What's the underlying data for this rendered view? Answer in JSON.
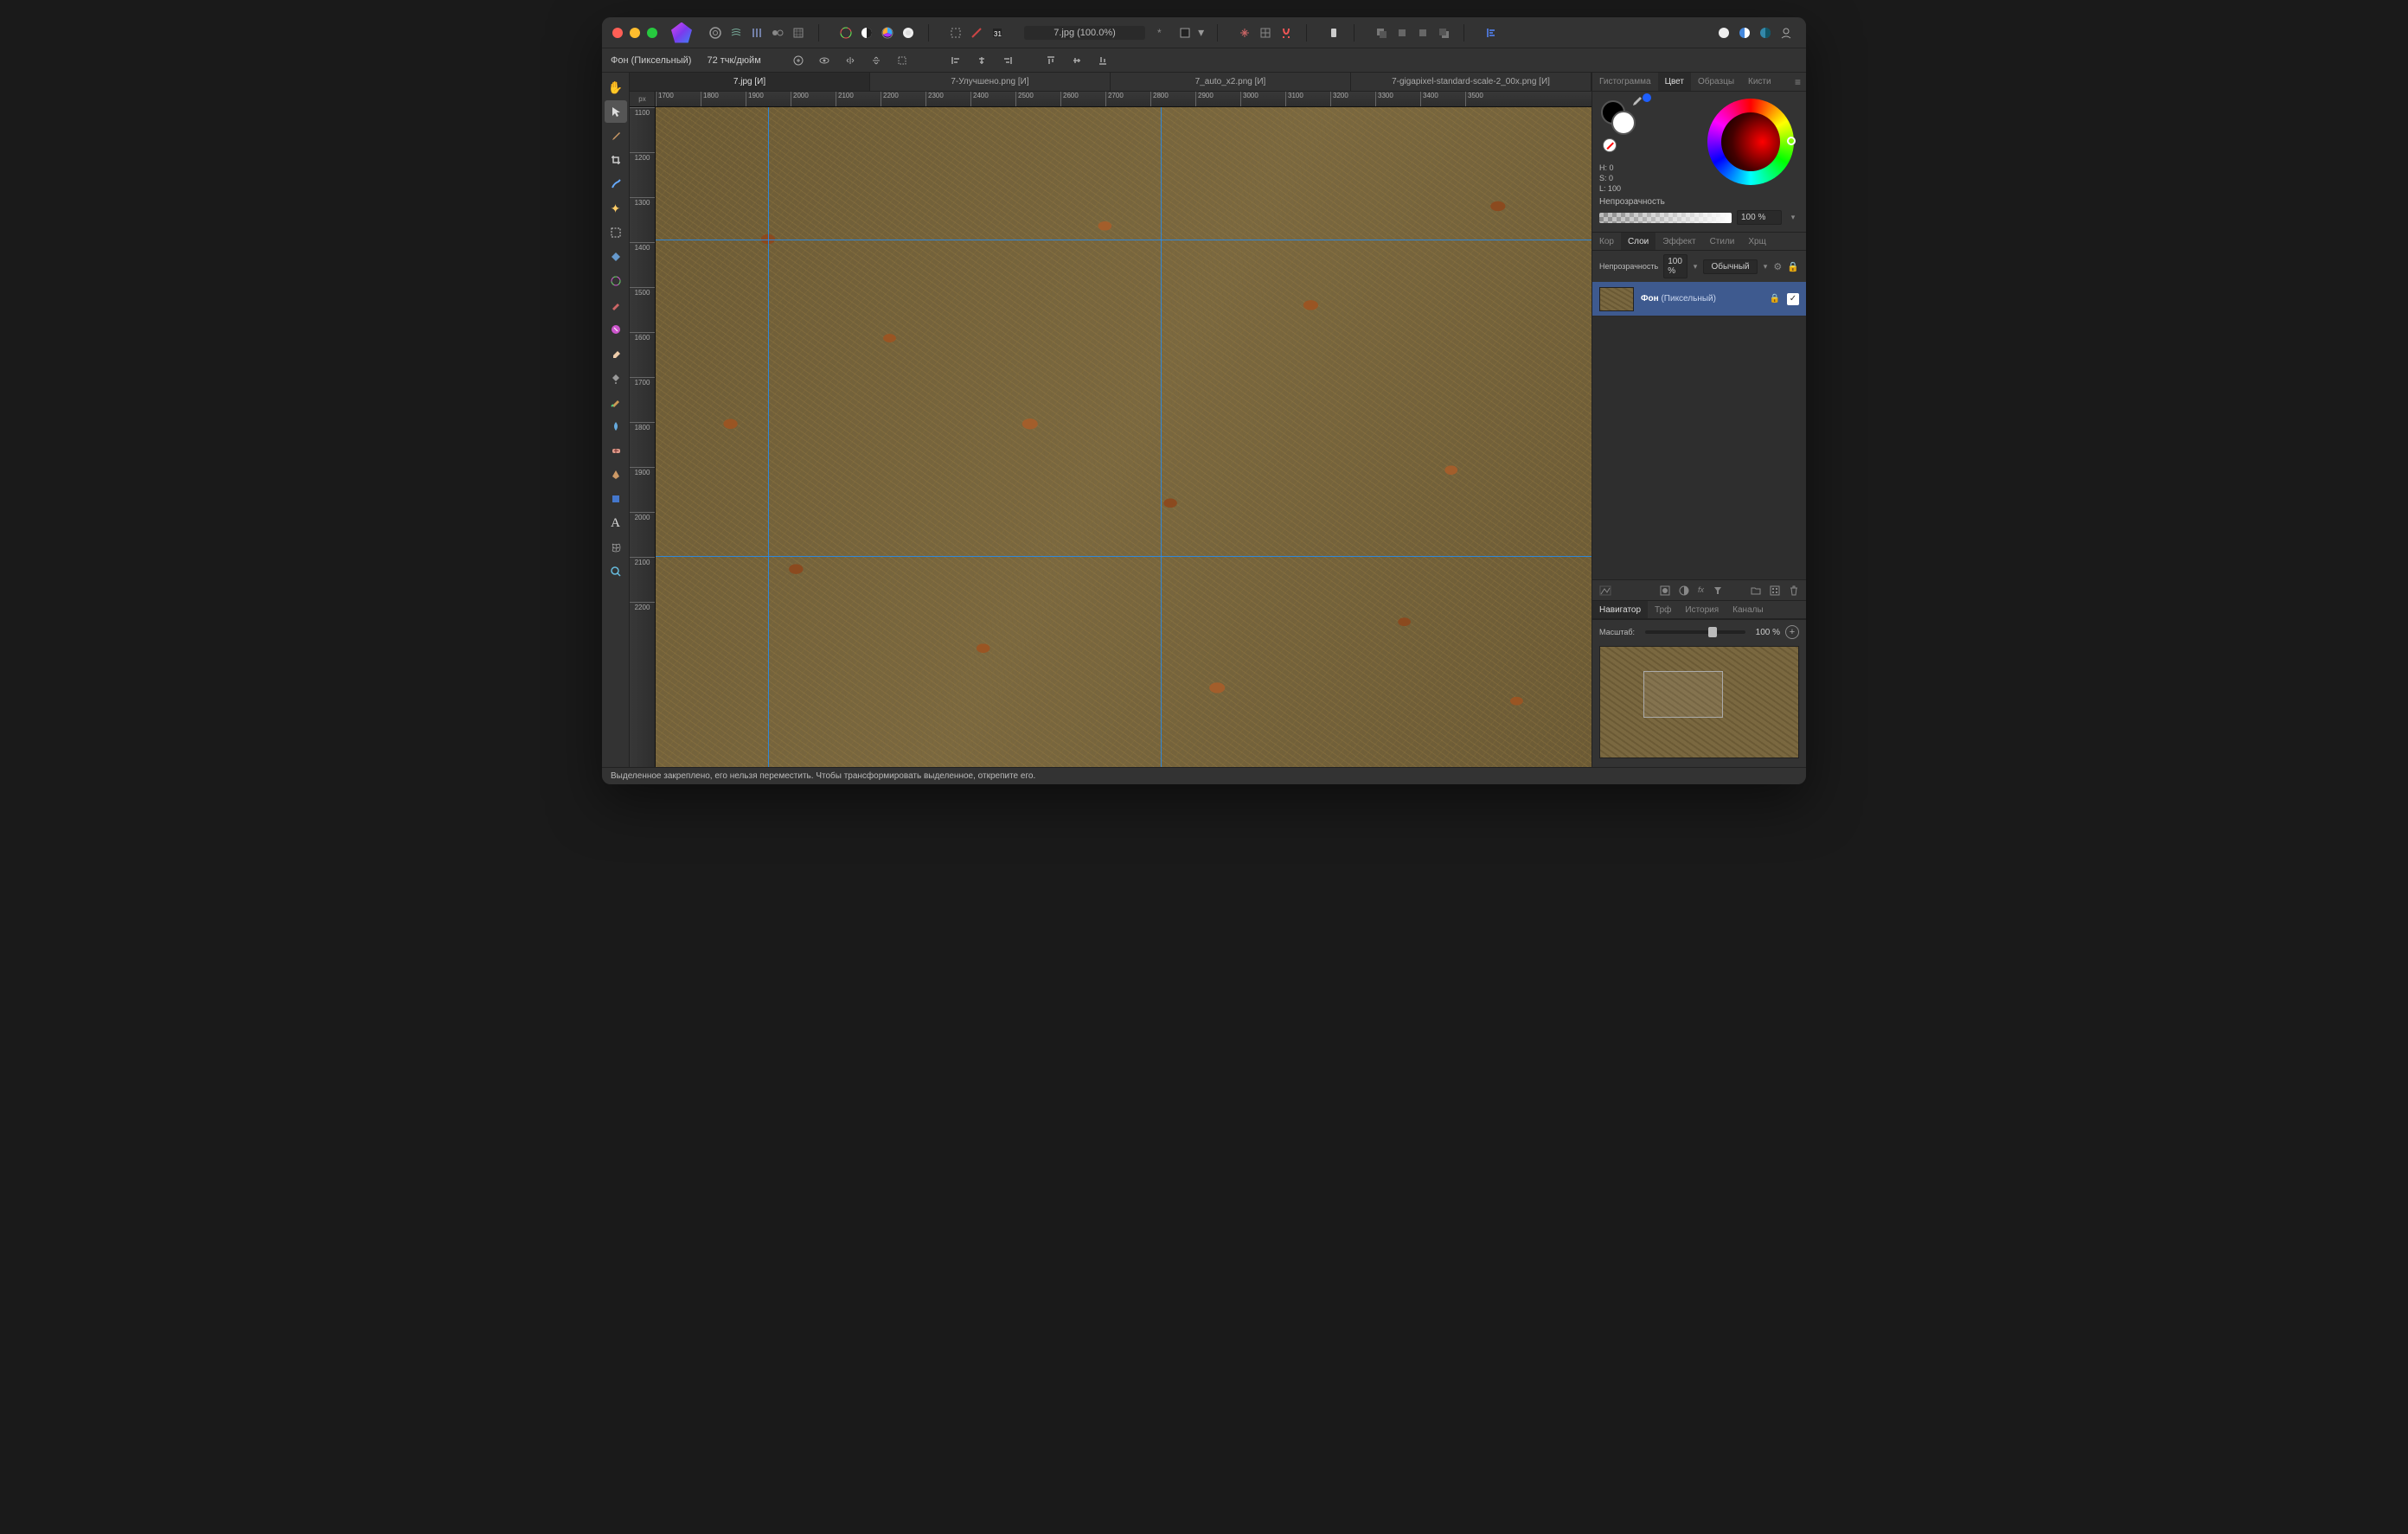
{
  "titlebar": {
    "doc_title": "7.jpg (100.0%)",
    "dirty_marker": "*"
  },
  "contextbar": {
    "layer_label": "Фон (Пиксельный)",
    "dpi": "72 тчк/дюйм"
  },
  "doc_tabs": [
    "7.jpg [И]",
    "7-Улучшено.png [И]",
    "7_auto_x2.png [И]",
    "7-gigapixel-standard-scale-2_00x.png [И]"
  ],
  "rulers": {
    "unit": "px",
    "h_ticks": [
      "1700",
      "1800",
      "1900",
      "2000",
      "2100",
      "2200",
      "2300",
      "2400",
      "2500",
      "2600",
      "2700",
      "2800",
      "2900",
      "3000",
      "3100",
      "3200",
      "3300",
      "3400",
      "3500"
    ],
    "v_ticks": [
      "1100",
      "1200",
      "1300",
      "1400",
      "1500",
      "1600",
      "1700",
      "1800",
      "1900",
      "2000",
      "2100",
      "2200"
    ]
  },
  "panel_tab_groups": {
    "color": [
      "Гистограмма",
      "Цвет",
      "Образцы",
      "Кисти"
    ],
    "layers": [
      "Кор",
      "Слои",
      "Эффект",
      "Стили",
      "Хрщ"
    ],
    "navigator": [
      "Навигатор",
      "Трф",
      "История",
      "Каналы"
    ]
  },
  "color_panel": {
    "hsl": {
      "h": "H: 0",
      "s": "S: 0",
      "l": "L: 100"
    },
    "opacity_label": "Непрозрачность",
    "opacity_value": "100 %"
  },
  "layers_panel": {
    "opacity_label": "Непрозрачность",
    "opacity_value": "100 %",
    "blend_mode": "Обычный",
    "layers": [
      {
        "name": "Фон",
        "type": "(Пиксельный)",
        "locked": true,
        "visible": true
      }
    ]
  },
  "navigator_panel": {
    "zoom_label": "Масштаб:",
    "zoom_value": "100 %"
  },
  "status_message": "Выделенное закреплено, его нельзя переместить. Чтобы трансформировать выделенное, открепите его."
}
